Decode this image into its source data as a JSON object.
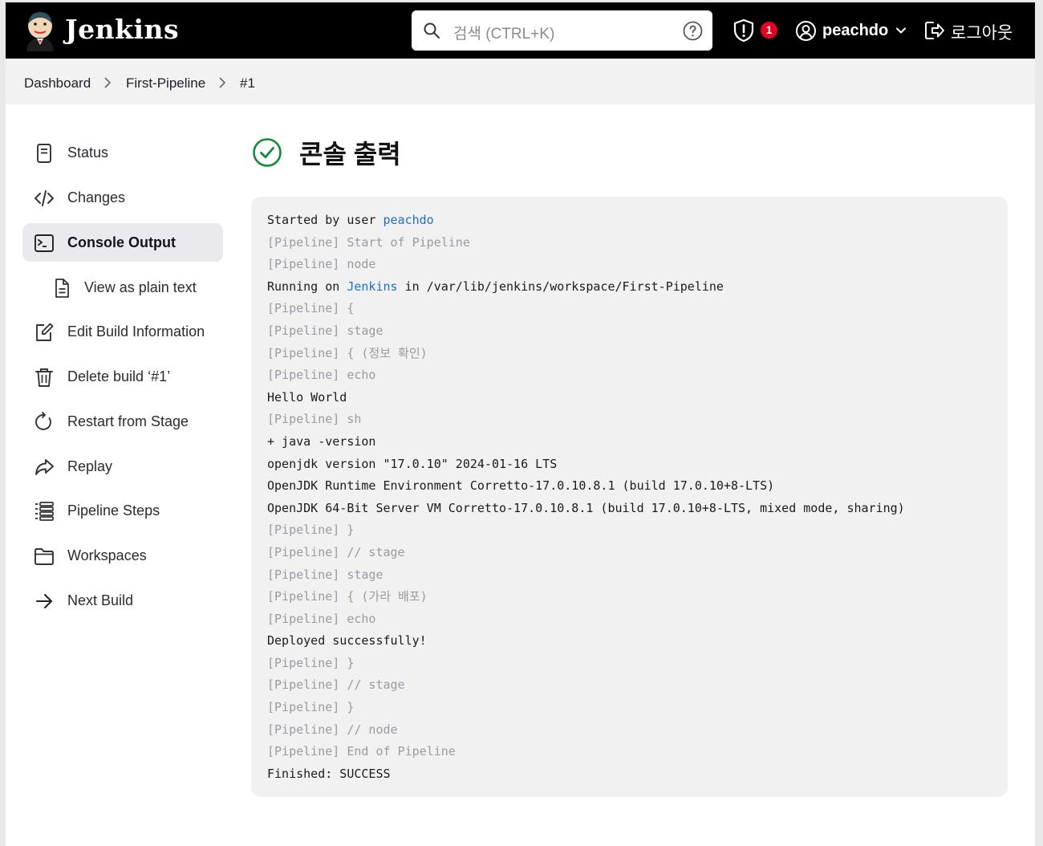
{
  "header": {
    "brand": "Jenkins",
    "search_placeholder": "검색 (CTRL+K)",
    "notification_count": "1",
    "username": "peachdo",
    "logout_label": "로그아웃"
  },
  "breadcrumb": [
    "Dashboard",
    "First-Pipeline",
    "#1"
  ],
  "sidebar": {
    "items": [
      {
        "label": "Status",
        "icon": "document-icon"
      },
      {
        "label": "Changes",
        "icon": "code-icon"
      },
      {
        "label": "Console Output",
        "icon": "terminal-icon"
      },
      {
        "label": "View as plain text",
        "icon": "file-text-icon"
      },
      {
        "label": "Edit Build Information",
        "icon": "edit-icon"
      },
      {
        "label": "Delete build ‘#1’",
        "icon": "trash-icon"
      },
      {
        "label": "Restart from Stage",
        "icon": "restart-icon"
      },
      {
        "label": "Replay",
        "icon": "replay-icon"
      },
      {
        "label": "Pipeline Steps",
        "icon": "list-icon"
      },
      {
        "label": "Workspaces",
        "icon": "folder-icon"
      },
      {
        "label": "Next Build",
        "icon": "arrow-right-icon"
      }
    ]
  },
  "main": {
    "title": "콘솔 출력",
    "status": "success",
    "console": {
      "line_1_prefix": "Started by user ",
      "line_1_link": "peachdo",
      "line_2": "[Pipeline] Start of Pipeline",
      "line_3": "[Pipeline] node",
      "line_4_prefix": "Running on ",
      "line_4_link": "Jenkins",
      "line_4_suffix": " in /var/lib/jenkins/workspace/First-Pipeline",
      "line_5": "[Pipeline] {",
      "line_6": "[Pipeline] stage",
      "line_7": "[Pipeline] { (정보 확인)",
      "line_8": "[Pipeline] echo",
      "line_9": "Hello World",
      "line_10": "[Pipeline] sh",
      "line_11": "+ java -version",
      "line_12": "openjdk version \"17.0.10\" 2024-01-16 LTS",
      "line_13": "OpenJDK Runtime Environment Corretto-17.0.10.8.1 (build 17.0.10+8-LTS)",
      "line_14": "OpenJDK 64-Bit Server VM Corretto-17.0.10.8.1 (build 17.0.10+8-LTS, mixed mode, sharing)",
      "line_15": "[Pipeline] }",
      "line_16": "[Pipeline] // stage",
      "line_17": "[Pipeline] stage",
      "line_18": "[Pipeline] { (가라 배포)",
      "line_19": "[Pipeline] echo",
      "line_20": "Deployed successfully!",
      "line_21": "[Pipeline] }",
      "line_22": "[Pipeline] // stage",
      "line_23": "[Pipeline] }",
      "line_24": "[Pipeline] // node",
      "line_25": "[Pipeline] End of Pipeline",
      "line_26": "Finished: SUCCESS"
    }
  },
  "colors": {
    "header_bg": "#000000",
    "success": "#138a36",
    "link": "#1c70c8",
    "badge": "#e6001f"
  }
}
